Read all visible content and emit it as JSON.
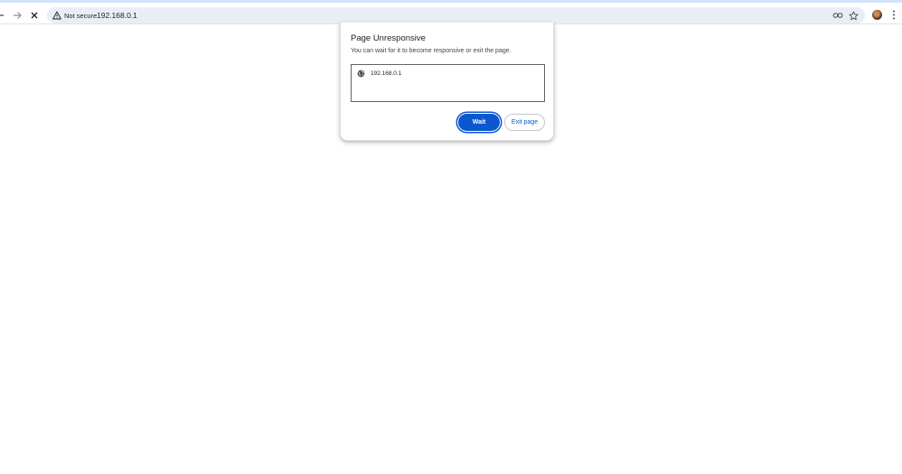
{
  "browser": {
    "security_label": "Not secure",
    "url": "192.168.0.1",
    "accent_color": "#0b57d0",
    "icons": {
      "back": "back-arrow-icon",
      "forward": "forward-arrow-icon",
      "stop": "close-icon",
      "security": "warning-triangle-icon",
      "password": "key-icon",
      "bookmark": "star-icon",
      "profile": "avatar",
      "menu": "kebab-menu-icon"
    }
  },
  "dialog": {
    "title": "Page Unresponsive",
    "message": "You can wait for it to become responsive or exit the page.",
    "pages": [
      {
        "label": "192.168.0.1",
        "icon": "globe-icon"
      }
    ],
    "buttons": {
      "wait": "Wait",
      "exit": "Exit page"
    }
  }
}
